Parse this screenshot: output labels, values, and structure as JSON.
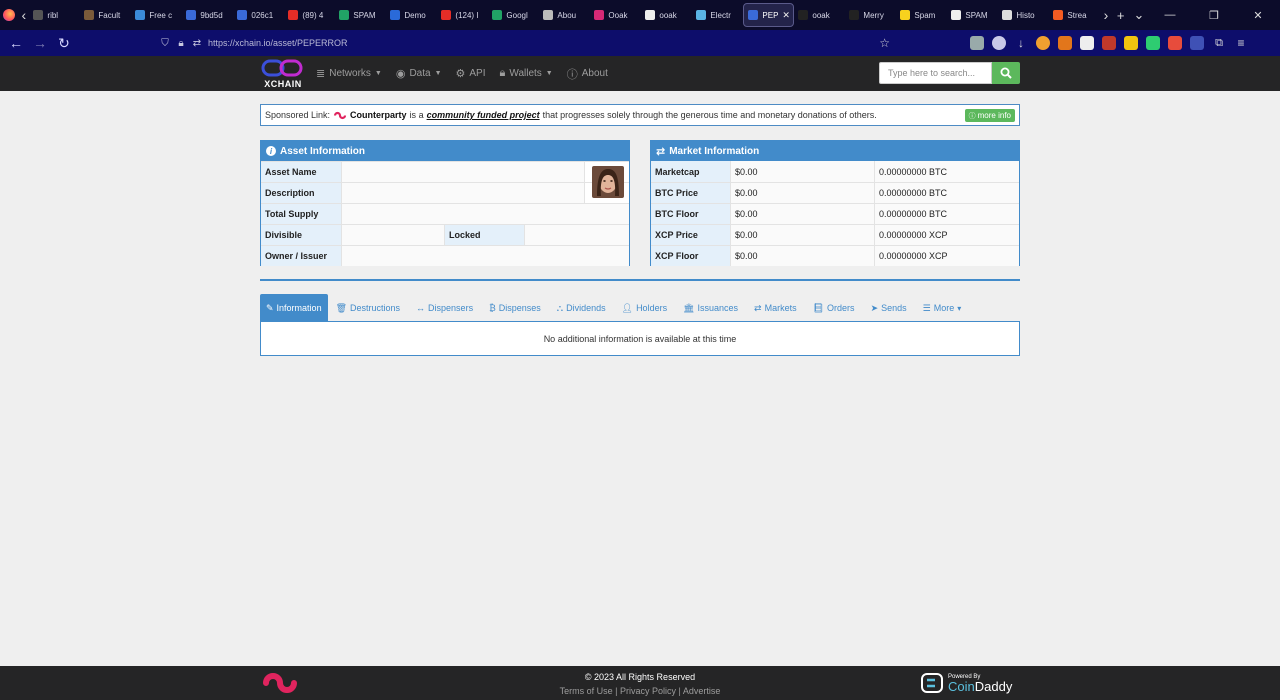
{
  "browser": {
    "tabs": [
      {
        "label": "ribl",
        "color": "#555555"
      },
      {
        "label": "Facult",
        "color": "#7a5a3a"
      },
      {
        "label": "Free c",
        "color": "#3b8ad9"
      },
      {
        "label": "9bd5d",
        "color": "#3a6ad9"
      },
      {
        "label": "026c1",
        "color": "#3a6ad9"
      },
      {
        "label": "(89) 4",
        "color": "#e52d27"
      },
      {
        "label": "SPAM",
        "color": "#21a366"
      },
      {
        "label": "Demo",
        "color": "#2a6ad9"
      },
      {
        "label": "(124) I",
        "color": "#e52d27"
      },
      {
        "label": "Googl",
        "color": "#21a366"
      },
      {
        "label": "Abou",
        "color": "#bbbbbb"
      },
      {
        "label": "Ooak",
        "color": "#d62976"
      },
      {
        "label": "ooak",
        "color": "#eeeeee"
      },
      {
        "label": "Electr",
        "color": "#5ab4e5"
      },
      {
        "label": "PEP",
        "color": "#3a6ad9"
      },
      {
        "label": "ooak",
        "color": "#222222"
      },
      {
        "label": "Merry",
        "color": "#222222"
      },
      {
        "label": "Spam",
        "color": "#f7d21e"
      },
      {
        "label": "SPAM",
        "color": "#eeeeee"
      },
      {
        "label": "Histo",
        "color": "#dddddd"
      },
      {
        "label": "Strea",
        "color": "#f35b22"
      }
    ],
    "active_tab_index": 14,
    "url": "https://xchain.io/asset/PEPERROR"
  },
  "header": {
    "logo_text": "XCHAIN",
    "nav": [
      {
        "label": "Networks",
        "icon": "database-icon",
        "caret": true
      },
      {
        "label": "Data",
        "icon": "dashboard-icon",
        "caret": true
      },
      {
        "label": "API",
        "icon": "cogs-icon",
        "caret": false
      },
      {
        "label": "Wallets",
        "icon": "lock-icon",
        "caret": true
      },
      {
        "label": "About",
        "icon": "info-icon",
        "caret": false
      }
    ],
    "search_placeholder": "Type here to search..."
  },
  "sponsor": {
    "prefix": "Sponsored Link:",
    "brand": "Counterparty",
    "mid": "is a",
    "project": "community funded project",
    "suffix": "that progresses solely through the generous time and monetary donations of others.",
    "button": "more info"
  },
  "asset_info": {
    "title": "Asset Information",
    "labels": {
      "name": "Asset Name",
      "description": "Description",
      "supply": "Total Supply",
      "divisible": "Divisible",
      "locked": "Locked",
      "owner": "Owner / Issuer"
    }
  },
  "market_info": {
    "title": "Market Information",
    "rows": [
      {
        "label": "Marketcap",
        "usd": "$0.00",
        "alt": "0.00000000 BTC"
      },
      {
        "label": "BTC Price",
        "usd": "$0.00",
        "alt": "0.00000000 BTC"
      },
      {
        "label": "BTC Floor",
        "usd": "$0.00",
        "alt": "0.00000000 BTC"
      },
      {
        "label": "XCP Price",
        "usd": "$0.00",
        "alt": "0.00000000 XCP"
      },
      {
        "label": "XCP Floor",
        "usd": "$0.00",
        "alt": "0.00000000 XCP"
      }
    ]
  },
  "detail_tabs": [
    {
      "label": "Information",
      "icon": "pencil-icon"
    },
    {
      "label": "Destructions",
      "icon": "trash-icon"
    },
    {
      "label": "Dispensers",
      "icon": "arrows-h-icon"
    },
    {
      "label": "Dispenses",
      "icon": "bitcoin-icon"
    },
    {
      "label": "Dividends",
      "icon": "sitemap-icon"
    },
    {
      "label": "Holders",
      "icon": "user-icon"
    },
    {
      "label": "Issuances",
      "icon": "bank-icon"
    },
    {
      "label": "Markets",
      "icon": "exchange-icon"
    },
    {
      "label": "Orders",
      "icon": "book-icon"
    },
    {
      "label": "Sends",
      "icon": "paper-plane-icon"
    },
    {
      "label": "More",
      "icon": "list-icon"
    }
  ],
  "tab_content_text": "No additional information is available at this time",
  "footer": {
    "copyright": "© 2023 All Rights Reserved",
    "links": [
      "Terms of Use",
      "Privacy Policy",
      "Advertise"
    ],
    "powered_by": "Powered By",
    "brand_a": "Coin",
    "brand_b": "Daddy"
  },
  "colors": {
    "primary": "#428bca",
    "success": "#5cb85c",
    "header_bg": "#252526",
    "counterparty_red": "#e0245e"
  }
}
